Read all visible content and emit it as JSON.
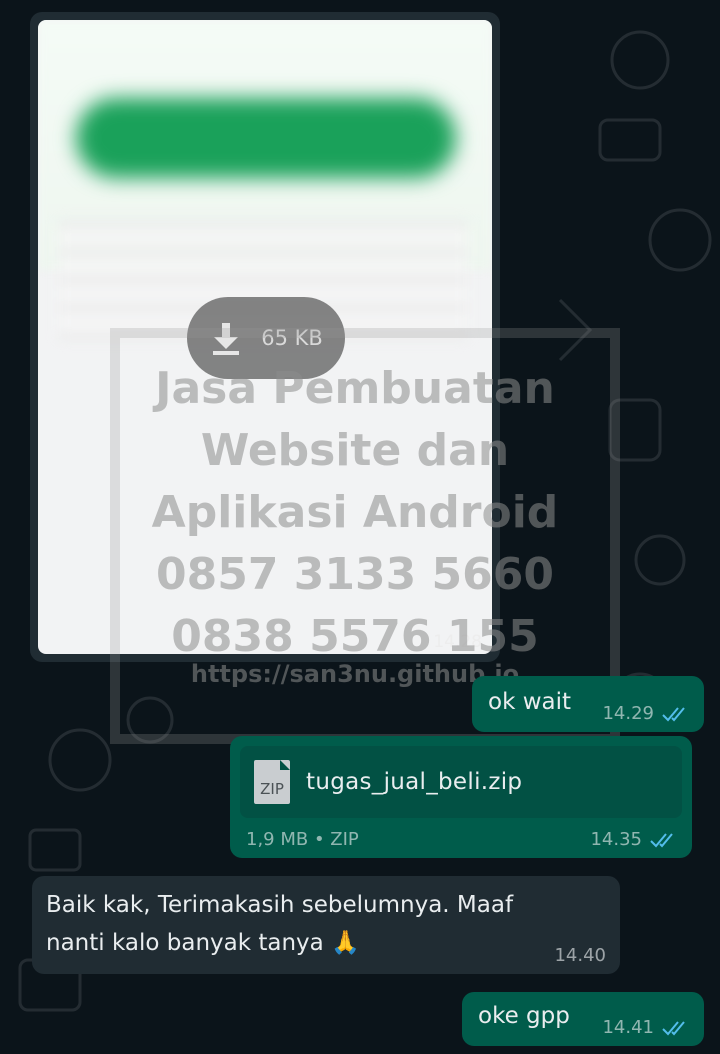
{
  "image_message": {
    "download_size": "65 KB",
    "time": "14.28"
  },
  "watermark": {
    "lines": [
      "Jasa Pembuatan",
      "Website dan",
      "Aplikasi Android",
      "0857 3133 5660",
      "0838 5576 155"
    ],
    "url": "https://san3nu.github.io"
  },
  "messages": {
    "ok_wait": {
      "text": "ok wait",
      "time": "14.29"
    },
    "zip": {
      "filename": "tugas_jual_beli.zip",
      "icon_label": "ZIP",
      "info": "1,9 MB • ZIP",
      "time": "14.35"
    },
    "baik": {
      "line1": "Baik kak, Terimakasih sebelumnya. Maaf",
      "line2": "nanti kalo banyak tanya",
      "emoji": "🙏",
      "time": "14.40"
    },
    "oke": {
      "text": "oke gpp",
      "time": "14.41"
    }
  },
  "colors": {
    "background": "#0b141a",
    "outgoing_bubble": "#005c4b",
    "incoming_bubble": "#202c33",
    "read_tick": "#53bdeb"
  }
}
